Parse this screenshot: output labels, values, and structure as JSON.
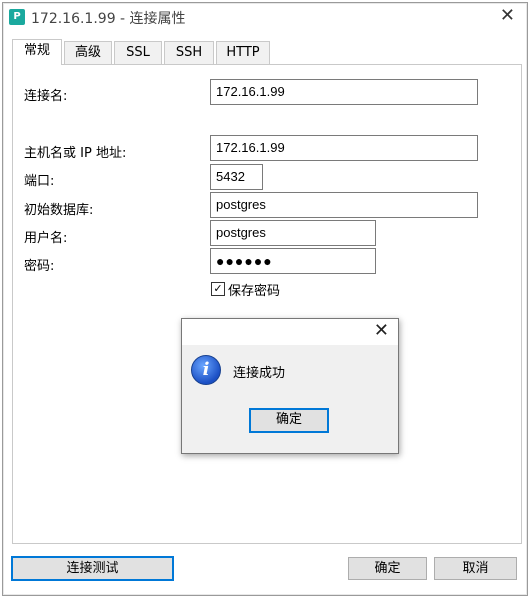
{
  "window": {
    "icon_label": "P",
    "title": "172.16.1.99 - 连接属性",
    "close_glyph": "✕"
  },
  "tabs": [
    {
      "label": "常规",
      "active": true
    },
    {
      "label": "高级"
    },
    {
      "label": "SSL"
    },
    {
      "label": "SSH"
    },
    {
      "label": "HTTP"
    }
  ],
  "form": {
    "connection_name_label": "连接名:",
    "connection_name_value": "172.16.1.99",
    "host_label": "主机名或 IP 地址:",
    "host_value": "172.16.1.99",
    "port_label": "端口:",
    "port_value": "5432",
    "database_label": "初始数据库:",
    "database_value": "postgres",
    "username_label": "用户名:",
    "username_value": "postgres",
    "password_label": "密码:",
    "password_value": "●●●●●●",
    "save_password_label": "保存密码",
    "save_password_checked": true,
    "check_glyph": "✓"
  },
  "buttons": {
    "test_connection": "连接测试",
    "ok": "确定",
    "cancel": "取消"
  },
  "dialog": {
    "close_glyph": "✕",
    "icon_glyph": "i",
    "message": "连接成功",
    "ok_button": "确定"
  }
}
